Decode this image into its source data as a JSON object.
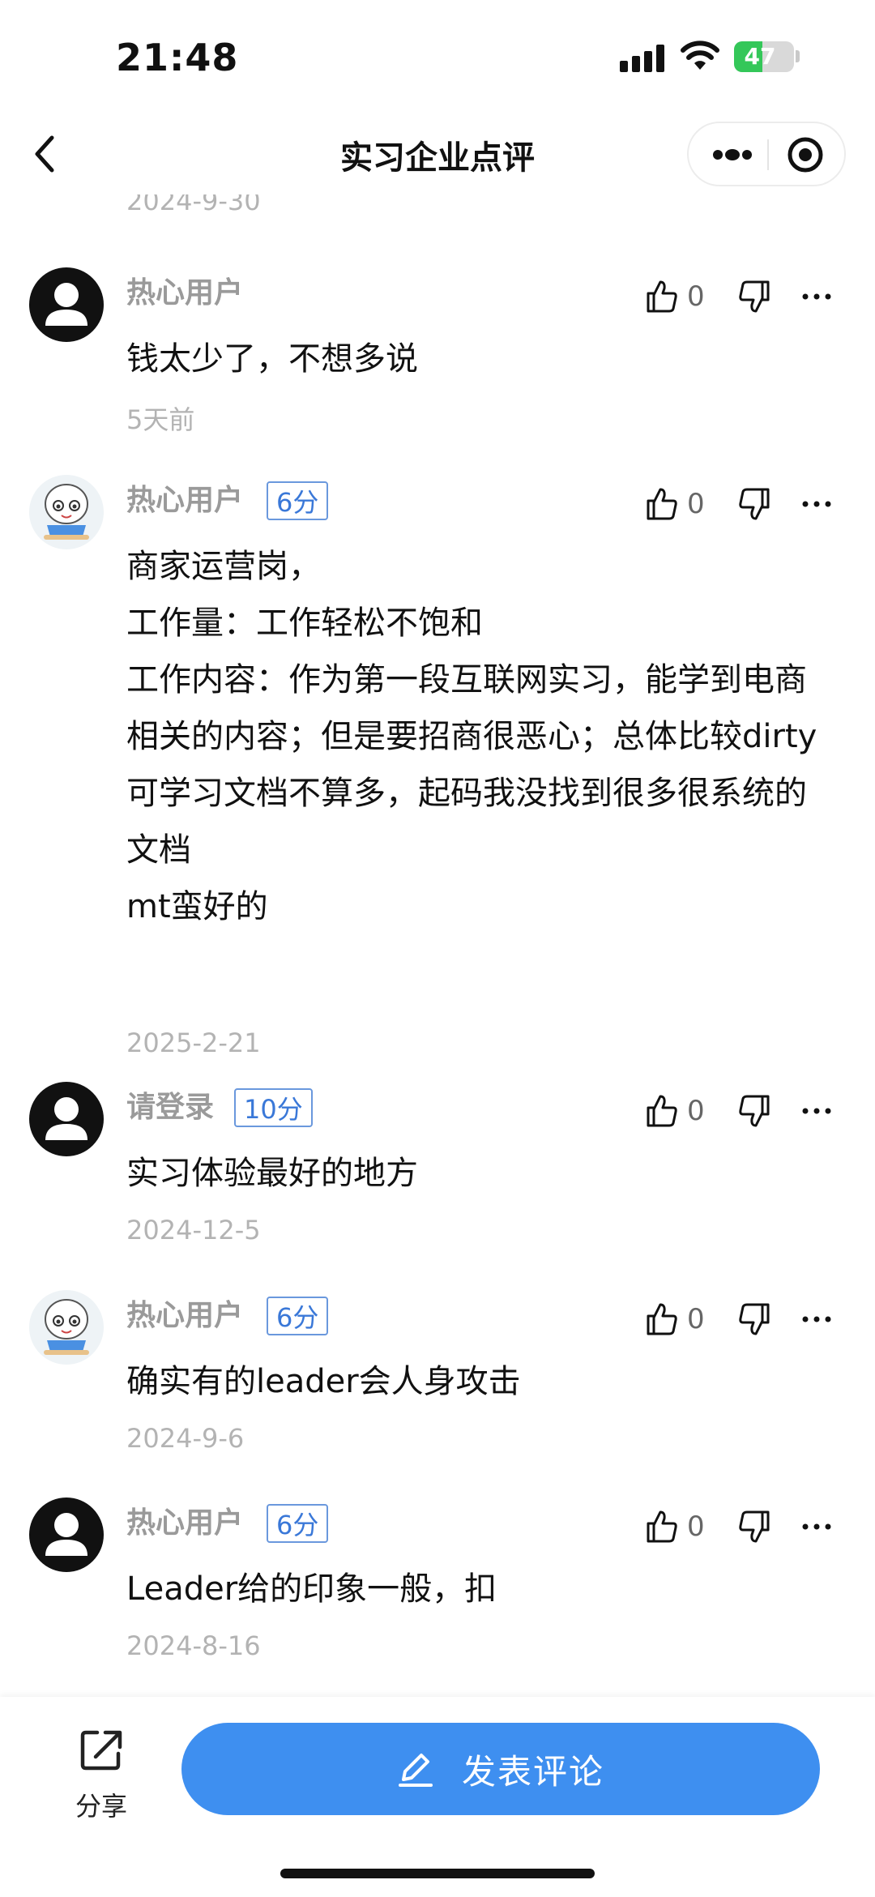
{
  "status_bar": {
    "time": "21:48",
    "battery": "47",
    "battery_level": 0.47
  },
  "nav": {
    "title": "实习企业点评"
  },
  "top_partial_date": "2024-9-30",
  "comments": [
    {
      "user": "热心用户",
      "avatar": "default-avatar",
      "badge": "",
      "likes": "0",
      "text": "钱太少了，不想多说",
      "date": "5天前"
    },
    {
      "user": "热心用户",
      "avatar": "cartoon-avatar",
      "badge": "6分",
      "likes": "0",
      "text": "商家运营岗，\n工作量：工作轻松不饱和\n工作内容：作为第一段互联网实习，能学到电商相关的内容；但是要招商很恶心；总体比较dirty\n可学习文档不算多，起码我没找到很多很系统的文档\nmt蛮好的",
      "date": "2025-2-21"
    },
    {
      "user": "请登录",
      "avatar": "default-avatar",
      "badge": "10分",
      "likes": "0",
      "text": "实习体验最好的地方",
      "date": "2024-12-5"
    },
    {
      "user": "热心用户",
      "avatar": "cartoon-avatar",
      "badge": "6分",
      "likes": "0",
      "text": "确实有的leader会人身攻击",
      "date": "2024-9-6"
    },
    {
      "user": "热心用户",
      "avatar": "default-avatar",
      "badge": "6分",
      "likes": "0",
      "text": "Leader给的印象一般，扣",
      "date": "2024-8-16"
    }
  ],
  "bottom_bar": {
    "share_label": "分享",
    "post_label": "发表评论"
  },
  "colors": {
    "accent": "#3e8ff0",
    "badge": "#3a78d8",
    "muted": "#b3b3b3"
  }
}
